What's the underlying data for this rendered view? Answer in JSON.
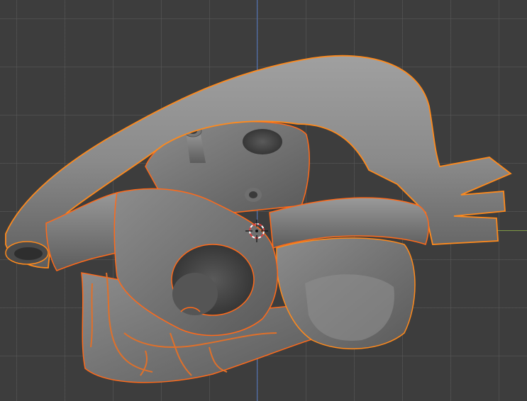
{
  "viewport": {
    "object": "heart",
    "selected": true,
    "colors": {
      "background": "#3d3d3d",
      "grid": "#555555",
      "axis_y": "#4a6fb8",
      "axis_x": "#7f9a45",
      "mesh": "#808080",
      "selection_outline": "#ff8a1c",
      "active_outline": "#ff6a1a",
      "cursor_red": "#e04040",
      "cursor_white": "#ffffff"
    },
    "icons": [
      "3d-cursor-icon"
    ]
  }
}
